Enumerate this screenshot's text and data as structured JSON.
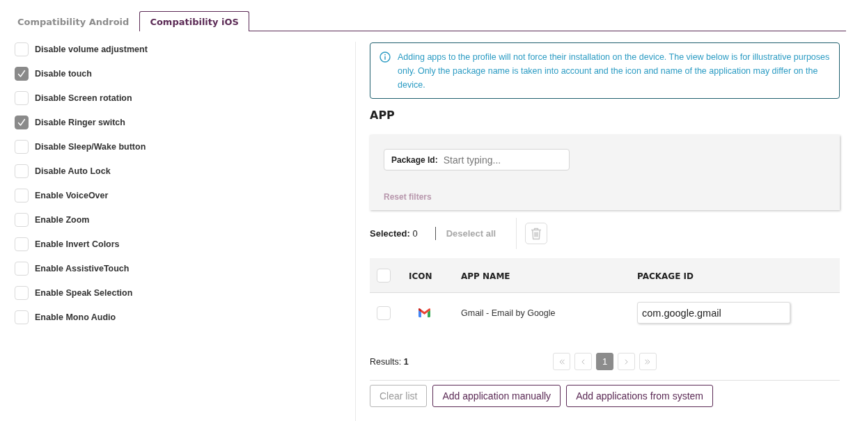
{
  "tabs": [
    {
      "label": "Compatibility Android",
      "selected": false
    },
    {
      "label": "Compatibility iOS",
      "selected": true
    }
  ],
  "options": [
    {
      "label": "Disable volume adjustment",
      "checked": false
    },
    {
      "label": "Disable touch",
      "checked": true
    },
    {
      "label": "Disable Screen rotation",
      "checked": false
    },
    {
      "label": "Disable Ringer switch",
      "checked": true
    },
    {
      "label": "Disable Sleep/Wake button",
      "checked": false
    },
    {
      "label": "Disable Auto Lock",
      "checked": false
    },
    {
      "label": "Enable VoiceOver",
      "checked": false
    },
    {
      "label": "Enable Zoom",
      "checked": false
    },
    {
      "label": "Enable Invert Colors",
      "checked": false
    },
    {
      "label": "Enable AssistiveTouch",
      "checked": false
    },
    {
      "label": "Enable Speak Selection",
      "checked": false
    },
    {
      "label": "Enable Mono Audio",
      "checked": false
    }
  ],
  "info_notice": {
    "text": "Adding apps to the profile will not force their installation on the device. The view below is for illustrative purposes only. Only the package name is taken into account and the icon and name of the application may differ on the device."
  },
  "app_section": {
    "title": "APP",
    "filters": {
      "package_id": {
        "label": "Package Id:",
        "placeholder": "Start typing..."
      },
      "reset": {
        "label": "Reset filters",
        "disabled": true
      }
    },
    "selection": {
      "text": "**Selected:** 0",
      "deselect_all": {
        "label": "Deselect all",
        "disabled": true
      },
      "delete": {
        "disabled": true
      }
    },
    "table": {
      "select_all_checked": false,
      "columns": [
        {
          "label": "ICON"
        },
        {
          "label": "APP NAME"
        },
        {
          "label": "PACKAGE ID"
        }
      ],
      "rows": [
        {
          "checked": false,
          "app_name": "Gmail - Email by Google",
          "package_id": "com.google.gmail"
        }
      ]
    },
    "results": "Results: **1**",
    "pagination": [
      {
        "kind": "first",
        "disabled": true
      },
      {
        "kind": "prev",
        "disabled": true
      },
      {
        "kind": "page",
        "label": "1",
        "selected": true
      },
      {
        "kind": "next",
        "disabled": true
      },
      {
        "kind": "last",
        "disabled": true
      }
    ],
    "buttons": [
      {
        "label": "Clear list",
        "disabled": true
      },
      {
        "label": "Add application manually",
        "disabled": false
      },
      {
        "label": "Add applications from system",
        "disabled": false
      }
    ]
  }
}
